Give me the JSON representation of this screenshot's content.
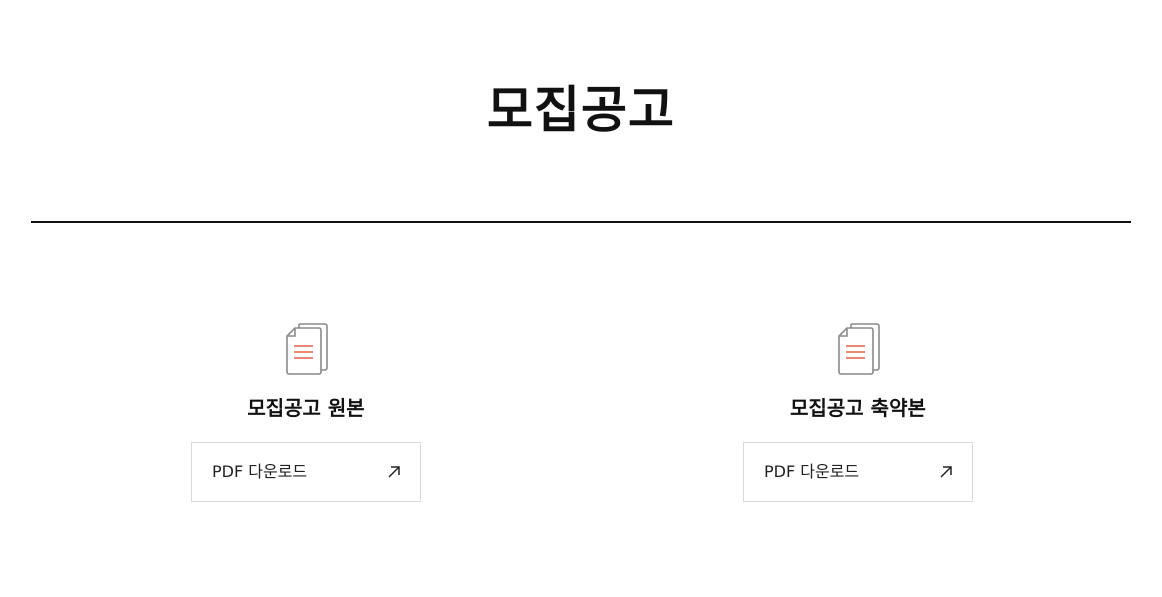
{
  "page": {
    "title": "모집공고"
  },
  "documents": [
    {
      "title": "모집공고 원본",
      "button_label": "PDF 다운로드",
      "icon": "document-icon",
      "action_icon": "arrow-up-right-icon"
    },
    {
      "title": "모집공고 축약본",
      "button_label": "PDF 다운로드",
      "icon": "document-icon",
      "action_icon": "arrow-up-right-icon"
    }
  ],
  "colors": {
    "text": "#111111",
    "divider": "#111111",
    "button_border": "#d9d9d9",
    "icon_outline": "#8a8a8a",
    "icon_lines": "#e0614a"
  }
}
